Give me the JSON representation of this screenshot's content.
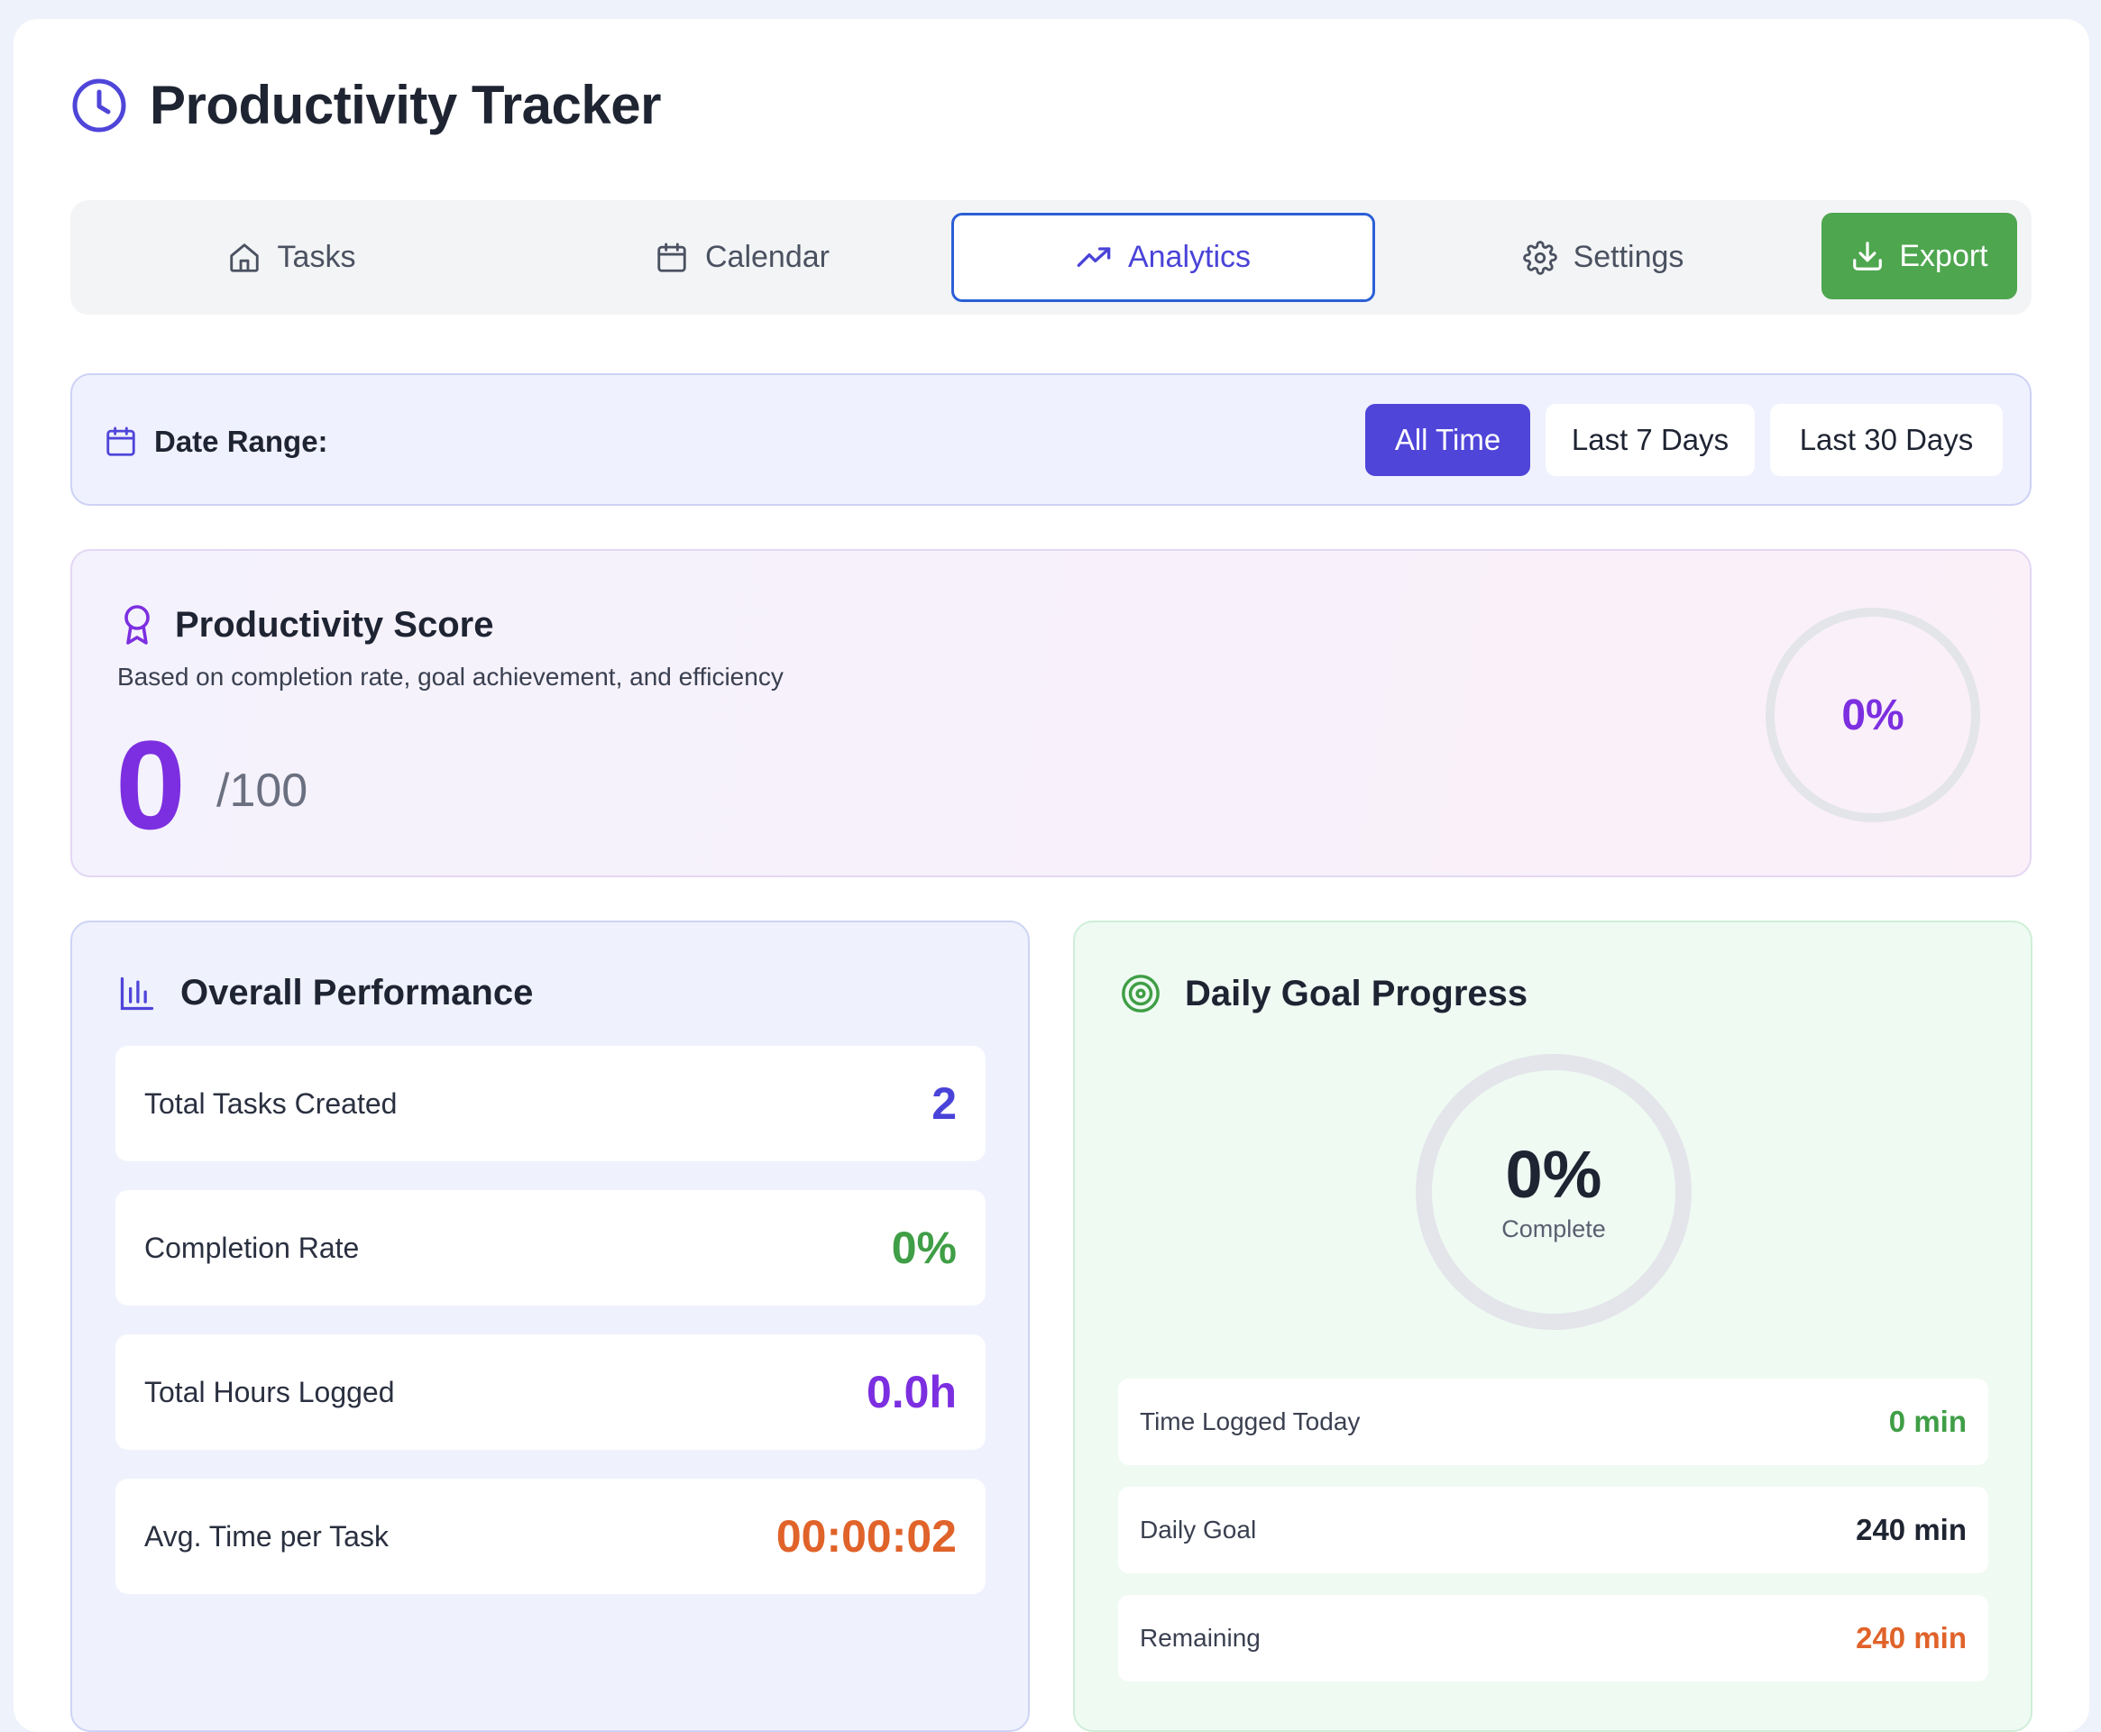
{
  "app": {
    "title": "Productivity Tracker"
  },
  "nav": {
    "tabs": [
      {
        "label": "Tasks",
        "icon": "home-icon"
      },
      {
        "label": "Calendar",
        "icon": "calendar-icon"
      },
      {
        "label": "Analytics",
        "icon": "trending-up-icon",
        "active": true
      },
      {
        "label": "Settings",
        "icon": "gear-icon"
      }
    ],
    "export_label": "Export"
  },
  "date_range": {
    "label": "Date Range:",
    "options": [
      "All Time",
      "Last 7 Days",
      "Last 30 Days"
    ],
    "selected": "All Time"
  },
  "score": {
    "title": "Productivity Score",
    "subtitle": "Based on completion rate, goal achievement, and efficiency",
    "value": "0",
    "max": "/100",
    "ring_label": "0%",
    "ring_fraction": 0
  },
  "performance": {
    "title": "Overall Performance",
    "stats": [
      {
        "label": "Total Tasks Created",
        "value": "2",
        "color": "#4a43d8"
      },
      {
        "label": "Completion Rate",
        "value": "0%",
        "color": "#3f9e46"
      },
      {
        "label": "Total Hours Logged",
        "value": "0.0h",
        "color": "#7c2fe0"
      },
      {
        "label": "Avg. Time per Task",
        "value": "00:00:02",
        "color": "#e0632a"
      }
    ]
  },
  "goal": {
    "title": "Daily Goal Progress",
    "ring_value": "0%",
    "ring_label": "Complete",
    "ring_fraction": 0,
    "rows": [
      {
        "label": "Time Logged Today",
        "value": "0 min",
        "color": "#3f9e46"
      },
      {
        "label": "Daily Goal",
        "value": "240 min",
        "color": "#1e2431"
      },
      {
        "label": "Remaining",
        "value": "240 min",
        "color": "#e0632a"
      }
    ]
  },
  "colors": {
    "accent": "#4f45d9",
    "purple": "#7c2fe0",
    "green": "#4ea64f",
    "orange": "#e0632a"
  }
}
